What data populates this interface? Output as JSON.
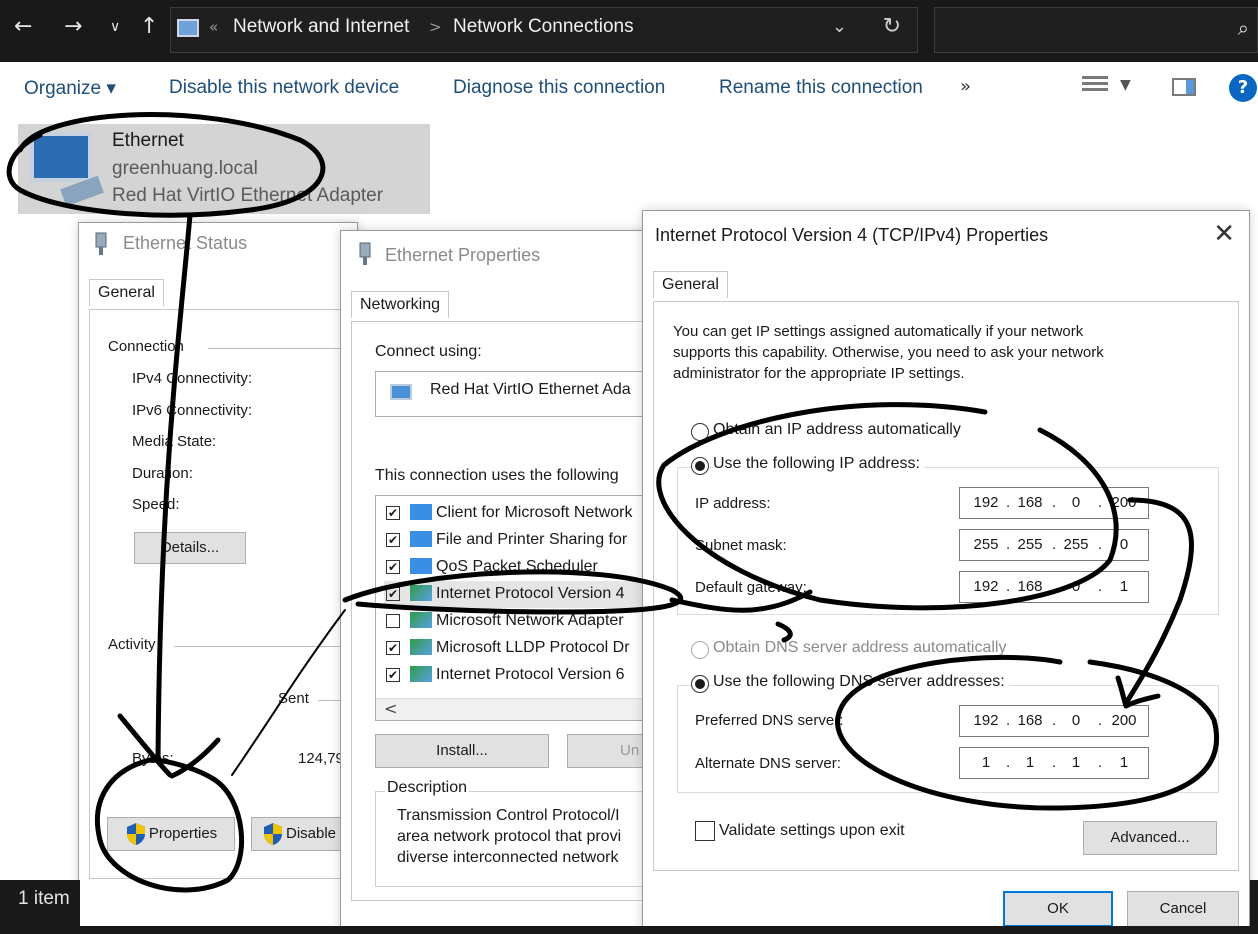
{
  "explorer": {
    "breadcrumb": [
      "Network and Internet",
      "Network Connections"
    ],
    "breadcrumb_overflow": "«",
    "breadcrumb_separator": ">",
    "search_placeholder": "",
    "toolbar": {
      "organize_label": "Organize ▾",
      "disable_label": "Disable this network device",
      "diagnose_label": "Diagnose this connection",
      "rename_label": "Rename this connection",
      "more_label": "»"
    },
    "adapter": {
      "name": "Ethernet",
      "domain": "greenhuang.local",
      "hardware": "Red Hat VirtIO Ethernet Adapter"
    },
    "status_bar": {
      "item_count": "1 item"
    },
    "icons": [
      "back-arrow-icon",
      "forward-arrow-icon",
      "chevron-down-icon",
      "up-arrow-icon",
      "computer-icon",
      "refresh-icon",
      "search-icon",
      "view-options-icon",
      "preview-pane-icon",
      "help-icon"
    ]
  },
  "status_dialog": {
    "title": "Ethernet Status",
    "tab": "General",
    "connection_group": "Connection",
    "ipv4": "IPv4 Connectivity:",
    "ipv6": "IPv6 Connectivity:",
    "media": "Media State:",
    "duration": "Duration:",
    "speed": "Speed:",
    "details_button": "Details...",
    "activity_group": "Activity",
    "sent_label": "Sent",
    "bytes_label": "Bytes:",
    "bytes_sent": "124,79",
    "properties_button": "Properties",
    "disable_button": "Disable"
  },
  "properties_dialog": {
    "title": "Ethernet Properties",
    "tab": "Networking",
    "connect_using": "Connect using:",
    "adapter": "Red Hat VirtIO Ethernet Ada",
    "uses_items": "This connection uses the following",
    "items": [
      {
        "label": "Client for Microsoft Network",
        "checked": "✔"
      },
      {
        "label": "File and Printer Sharing for",
        "checked": "✔"
      },
      {
        "label": "QoS Packet Scheduler",
        "checked": "✔"
      },
      {
        "label": "Internet Protocol Version 4",
        "checked": "✔"
      },
      {
        "label": "Microsoft Network Adapter",
        "checked": ""
      },
      {
        "label": "Microsoft LLDP Protocol Dr",
        "checked": "✔"
      },
      {
        "label": "Internet Protocol Version 6",
        "checked": "✔"
      }
    ],
    "scroll_left": "<",
    "install_button": "Install...",
    "uninstall_button": "Un",
    "description_group": "Description",
    "description_lines": [
      "Transmission Control Protocol/I",
      "area network protocol that provi",
      "diverse interconnected network"
    ]
  },
  "ipv4_dialog": {
    "title": "Internet Protocol Version 4 (TCP/IPv4) Properties",
    "tab": "General",
    "intro_lines": [
      "You can get IP settings assigned automatically if your network",
      "supports this capability. Otherwise, you need to ask your network",
      "administrator for the appropriate IP settings."
    ],
    "auto_ip_label": "Obtain an IP address automatically",
    "manual_ip_label": "Use the following IP address:",
    "ip_label": "IP address:",
    "ip": [
      "192",
      "168",
      "0",
      "200"
    ],
    "mask_label": "Subnet mask:",
    "mask": [
      "255",
      "255",
      "255",
      "0"
    ],
    "gateway_label": "Default gateway:",
    "gateway": [
      "192",
      "168",
      "0",
      "1"
    ],
    "auto_dns_label": "Obtain DNS server address automatically",
    "manual_dns_label": "Use the following DNS server addresses:",
    "pref_dns_label": "Preferred DNS server:",
    "pref_dns": [
      "192",
      "168",
      "0",
      "200"
    ],
    "alt_dns_label": "Alternate DNS server:",
    "alt_dns": [
      "1",
      "1",
      "1",
      "1"
    ],
    "validate_label": "Validate settings upon exit",
    "advanced_button": "Advanced...",
    "ok_button": "OK",
    "cancel_button": "Cancel",
    "close_glyph": "✕"
  },
  "colors": {
    "titlebar_dark": "#191919",
    "link_blue": "#1f4e79",
    "annotation_ink": "#000000",
    "focus_blue": "#0078d7"
  }
}
